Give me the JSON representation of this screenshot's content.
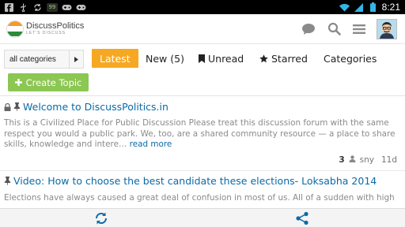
{
  "status_bar": {
    "time": "8:21",
    "notification_badge": "99",
    "icons": [
      "facebook-icon",
      "usb-icon",
      "sync-icon",
      "notification-count-badge",
      "gamepad-icon",
      "gamepad-icon",
      "wifi-icon",
      "signal-icon",
      "battery-icon"
    ],
    "colors": {
      "background": "#000000",
      "time": "#ffffff"
    }
  },
  "header": {
    "logo_name": "DiscussPolitics",
    "logo_tagline": "LET'S DISCUSS",
    "actions": [
      "chat-bubble-icon",
      "search-icon",
      "hamburger-menu-icon",
      "avatar"
    ]
  },
  "nav": {
    "category_select": "all categories",
    "tabs": [
      {
        "label": "Latest",
        "active": true
      },
      {
        "label": "New (5)",
        "active": false
      },
      {
        "label": "Unread",
        "active": false,
        "icon": "bookmark-icon"
      },
      {
        "label": "Starred",
        "active": false,
        "icon": "star-icon"
      },
      {
        "label": "Categories",
        "active": false
      }
    ],
    "active_color": "#f7a823"
  },
  "create_topic": {
    "label": "Create Topic",
    "color": "#8cc653"
  },
  "topics": [
    {
      "title": "Welcome to DiscussPolitics.in",
      "icons": [
        "lock-icon",
        "pin-icon"
      ],
      "excerpt": "This is a Civilized Place for Public Discussion Please treat this discussion forum with the same respect you would a public park. We, too, are a shared community resource — a place to share skills, knowledge and intere…",
      "read_more": "read more",
      "posts": "3",
      "user": "sny",
      "age": "11d"
    },
    {
      "title": "Video: How to choose the best candidate these elections- Loksabha 2014",
      "icons": [
        "pin-icon"
      ],
      "excerpt": "Elections have always caused a great deal of confusion in most of us. All of a sudden with high"
    }
  ],
  "bottom_bar": {
    "buttons": [
      "refresh-icon",
      "share-icon"
    ],
    "icon_color": "#0a6aa8"
  },
  "colors": {
    "link": "#0a6aa8",
    "excerpt": "#8a8a8a"
  }
}
